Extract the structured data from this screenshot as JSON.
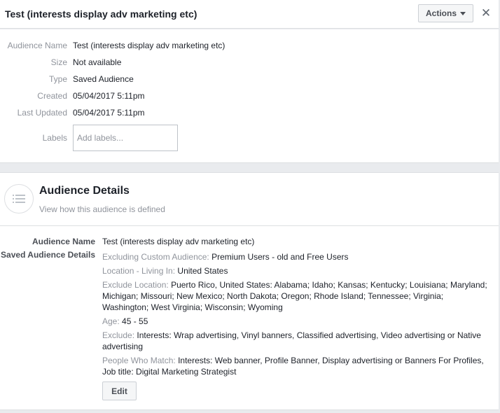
{
  "header": {
    "title": "Test (interests display adv marketing etc)",
    "actions_label": "Actions",
    "close_glyph": "✕"
  },
  "summary": {
    "name_label": "Audience Name",
    "name_value": "Test (interests display adv marketing etc)",
    "size_label": "Size",
    "size_value": "Not available",
    "type_label": "Type",
    "type_value": "Saved Audience",
    "created_label": "Created",
    "created_value": "05/04/2017 5:11pm",
    "updated_label": "Last Updated",
    "updated_value": "05/04/2017 5:11pm",
    "labels_label": "Labels",
    "labels_placeholder": "Add labels..."
  },
  "details": {
    "title": "Audience Details",
    "subtitle": "View how this audience is defined",
    "name_label": "Audience Name",
    "name_value": "Test (interests display adv marketing etc)",
    "saved_label": "Saved Audience Details",
    "exclude_custom_key": "Excluding Custom Audience:",
    "exclude_custom_value": "Premium Users - old and Free Users",
    "location_key": "Location - Living In:",
    "location_value": "United States",
    "exclude_location_key": "Exclude Location:",
    "exclude_location_value": "Puerto Rico, United States: Alabama; Idaho; Kansas; Kentucky; Louisiana; Maryland; Michigan; Missouri; New Mexico; North Dakota; Oregon; Rhode Island; Tennessee; Virginia; Washington; West Virginia; Wisconsin; Wyoming",
    "age_key": "Age:",
    "age_value": "45 - 55",
    "exclude_key": "Exclude:",
    "exclude_value": "Interests: Wrap advertising, Vinyl banners, Classified advertising, Video advertising or Native advertising",
    "match_key": "People Who Match:",
    "match_value": "Interests: Web banner, Profile Banner, Display advertising or Banners For Profiles, Job title: Digital Marketing Strategist",
    "edit_label": "Edit"
  },
  "icons": {
    "close": "close-icon",
    "caret": "caret-down-icon",
    "details": "list-icon"
  },
  "colors": {
    "text": "#1d2129",
    "muted": "#90949c",
    "border": "#dddfe2",
    "background": "#e9ebee"
  }
}
